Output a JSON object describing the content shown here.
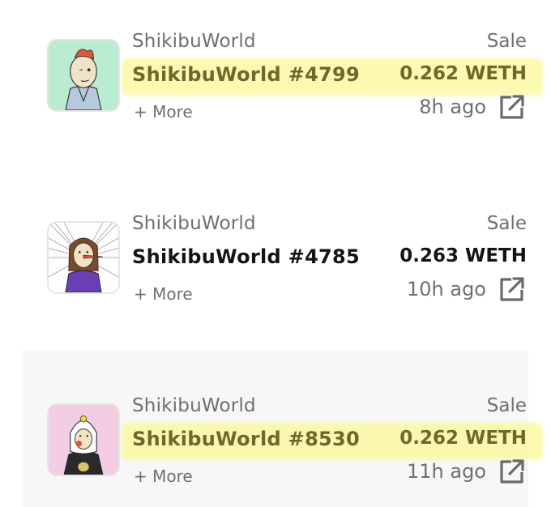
{
  "colors": {
    "highlight": "#faf896",
    "text_primary": "#141414",
    "text_secondary": "#6f6f6f",
    "highlighted_text": "#6b6a2c",
    "shaded_row_background": "#f7f7f7"
  },
  "activity": [
    {
      "collection": "ShikibuWorld",
      "title": "ShikibuWorld #4799",
      "more": "+ More",
      "event": "Sale",
      "price": "0.262 WETH",
      "time": "8h ago",
      "highlighted": true,
      "thumbnail_icon": "mint-green-character-avatar",
      "link_icon": "external-link-icon"
    },
    {
      "collection": "ShikibuWorld",
      "title": "ShikibuWorld #4785",
      "more": "+ More",
      "event": "Sale",
      "price": "0.263 WETH",
      "time": "10h ago",
      "highlighted": false,
      "thumbnail_icon": "burst-character-avatar",
      "link_icon": "external-link-icon"
    },
    {
      "collection": "ShikibuWorld",
      "title": "ShikibuWorld #8530",
      "more": "+ More",
      "event": "Sale",
      "price": "0.262 WETH",
      "time": "11h ago",
      "highlighted": true,
      "thumbnail_icon": "pink-character-avatar",
      "link_icon": "external-link-icon"
    }
  ]
}
